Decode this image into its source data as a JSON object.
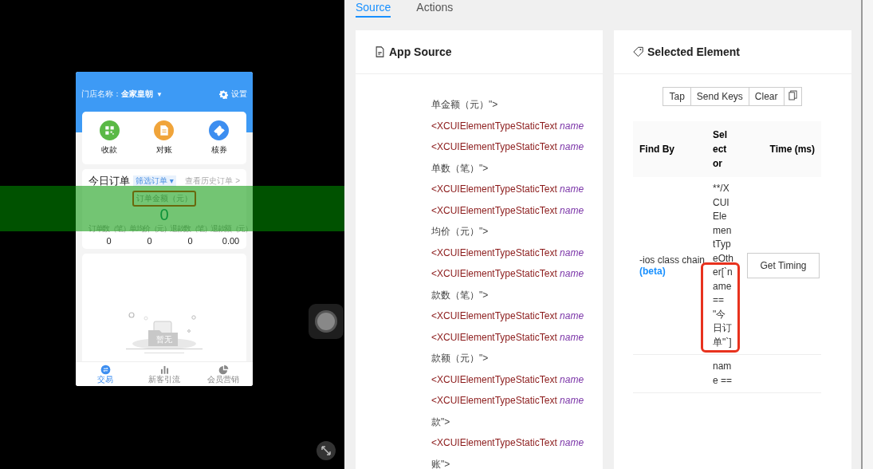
{
  "device": {
    "highlight_band": true,
    "phone": {
      "store_label": "门店名称：",
      "store_name": "金家皇朝",
      "store_caret": "▼",
      "settings": "设置",
      "quick_actions": [
        {
          "label": "收款",
          "kind": "qr",
          "color": "#5ab946"
        },
        {
          "label": "对账",
          "kind": "doc",
          "color": "#f0a43a"
        },
        {
          "label": "核券",
          "kind": "ticket",
          "color": "#3d8ef0"
        }
      ],
      "orders": {
        "title": "今日订单",
        "filter": "筛选订单 ▾",
        "history": "查看历史订单 >",
        "amount_label": {
          "text": "订单金额（元）",
          "highlighted": true
        },
        "amount": "0",
        "stats": [
          {
            "label": "订单数（笔）",
            "value": "0"
          },
          {
            "label": "单均价（元）",
            "value": "0"
          },
          {
            "label": "退款数（笔）",
            "value": "0"
          },
          {
            "label": "退款额（元）",
            "value": "0.00"
          }
        ]
      },
      "empty": "暂无",
      "tabs": [
        {
          "label": "交易",
          "kind": "swap",
          "selected": true
        },
        {
          "label": "新客引流",
          "kind": "bars",
          "selected": false
        },
        {
          "label": "会员营销",
          "kind": "pie",
          "selected": false
        }
      ]
    }
  },
  "inspector": {
    "tabs": [
      {
        "label": "Source",
        "selected": true
      },
      {
        "label": "Actions",
        "selected": false
      }
    ],
    "source": {
      "title": "App Source",
      "lines": [
        {
          "kind": "text",
          "text": "单金额（元）\">"
        },
        {
          "kind": "tag",
          "tag": "<XCUIElementTypeStaticText",
          "attr": "name"
        },
        {
          "kind": "tag",
          "tag": "<XCUIElementTypeStaticText",
          "attr": "name"
        },
        {
          "kind": "text",
          "text": "单数（笔）\">"
        },
        {
          "kind": "tag",
          "tag": "<XCUIElementTypeStaticText",
          "attr": "name"
        },
        {
          "kind": "tag",
          "tag": "<XCUIElementTypeStaticText",
          "attr": "name"
        },
        {
          "kind": "text",
          "text": "均价（元）\">"
        },
        {
          "kind": "tag",
          "tag": "<XCUIElementTypeStaticText",
          "attr": "name"
        },
        {
          "kind": "tag",
          "tag": "<XCUIElementTypeStaticText",
          "attr": "name"
        },
        {
          "kind": "text",
          "text": "款数（笔）\">"
        },
        {
          "kind": "tag",
          "tag": "<XCUIElementTypeStaticText",
          "attr": "name"
        },
        {
          "kind": "tag",
          "tag": "<XCUIElementTypeStaticText",
          "attr": "name"
        },
        {
          "kind": "text",
          "text": "款额（元）\">"
        },
        {
          "kind": "tag",
          "tag": "<XCUIElementTypeStaticText",
          "attr": "name"
        },
        {
          "kind": "tag",
          "tag": "<XCUIElementTypeStaticText",
          "attr": "name"
        },
        {
          "kind": "text",
          "text": "款\">"
        },
        {
          "kind": "tag",
          "tag": "<XCUIElementTypeStaticText",
          "attr": "name"
        },
        {
          "kind": "text",
          "text": "账\">"
        }
      ]
    },
    "selected": {
      "title": "Selected Element",
      "actions": [
        "Tap",
        "Send Keys",
        "Clear"
      ],
      "columns": [
        "Find By",
        "Selector",
        "Time (ms)"
      ],
      "rows": [
        {
          "find_by": "-ios class chain",
          "badge": "(beta)",
          "selector": "**/XCUIElementTypeOther[`name == \"今日订单\"`]",
          "highlighted": true,
          "action": "Get Timing"
        },
        {
          "selector": "name =="
        }
      ]
    }
  }
}
